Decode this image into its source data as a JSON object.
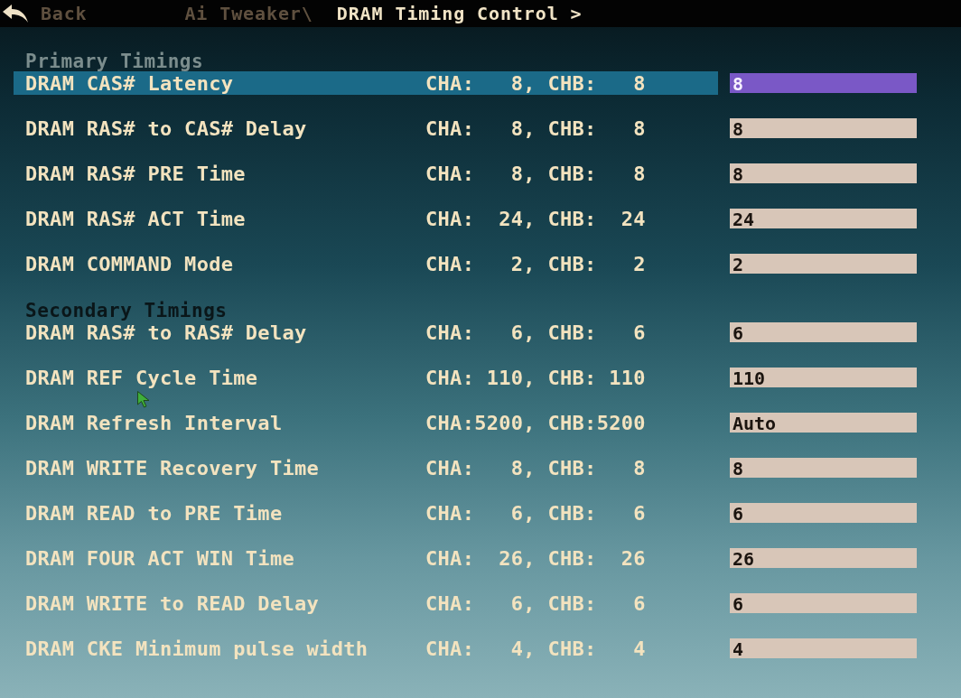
{
  "header": {
    "back": "Back",
    "breadcrumb": [
      {
        "label": "Ai Tweaker\\",
        "current": false
      },
      {
        "label": "DRAM Timing Control >",
        "current": true
      }
    ]
  },
  "sections": [
    {
      "title": "Primary Timings",
      "items": [
        {
          "label": "DRAM CAS# Latency",
          "timings": "CHA:   8, CHB:   8",
          "value": "8",
          "selected": true
        },
        {
          "label": "DRAM RAS# to CAS# Delay",
          "timings": "CHA:   8, CHB:   8",
          "value": "8",
          "selected": false
        },
        {
          "label": "DRAM RAS# PRE Time",
          "timings": "CHA:   8, CHB:   8",
          "value": "8",
          "selected": false
        },
        {
          "label": "DRAM RAS# ACT Time",
          "timings": "CHA:  24, CHB:  24",
          "value": "24",
          "selected": false
        },
        {
          "label": "DRAM COMMAND Mode",
          "timings": "CHA:   2, CHB:   2",
          "value": "2",
          "selected": false
        }
      ]
    },
    {
      "title": "Secondary Timings",
      "items": [
        {
          "label": "DRAM RAS# to RAS# Delay",
          "timings": "CHA:   6, CHB:   6",
          "value": "6",
          "selected": false
        },
        {
          "label": "DRAM REF Cycle Time",
          "timings": "CHA: 110, CHB: 110",
          "value": "110",
          "selected": false
        },
        {
          "label": "DRAM Refresh Interval",
          "timings": "CHA:5200, CHB:5200",
          "value": "Auto",
          "selected": false
        },
        {
          "label": "DRAM WRITE Recovery Time",
          "timings": "CHA:   8, CHB:   8",
          "value": "8",
          "selected": false
        },
        {
          "label": "DRAM READ to PRE Time",
          "timings": "CHA:   6, CHB:   6",
          "value": "6",
          "selected": false
        },
        {
          "label": "DRAM FOUR ACT WIN Time",
          "timings": "CHA:  26, CHB:  26",
          "value": "26",
          "selected": false
        },
        {
          "label": "DRAM WRITE to READ Delay",
          "timings": "CHA:   6, CHB:   6",
          "value": "6",
          "selected": false
        },
        {
          "label": "DRAM CKE Minimum pulse width",
          "timings": "CHA:   4, CHB:   4",
          "value": "4",
          "selected": false
        }
      ]
    }
  ]
}
